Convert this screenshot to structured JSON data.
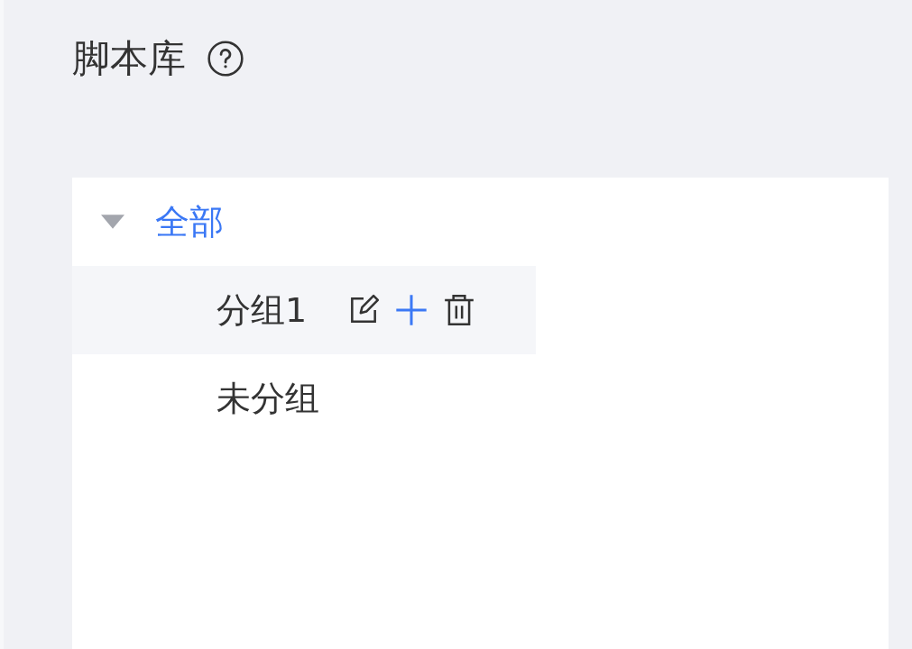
{
  "title": "脚本库",
  "tree": {
    "label": "全部",
    "expanded": true,
    "selected": true,
    "children": [
      {
        "label": "分组1",
        "selected": false,
        "hovered": true
      },
      {
        "label": "未分组",
        "selected": false,
        "hovered": false
      }
    ]
  }
}
